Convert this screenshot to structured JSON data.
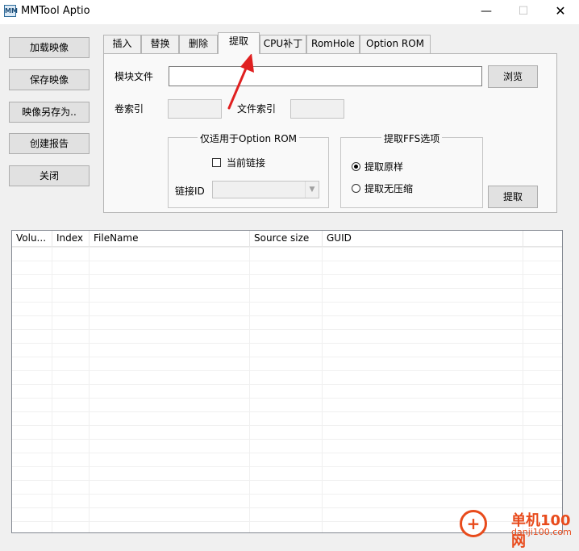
{
  "window": {
    "title": "MMTool Aptio",
    "icon_text": "MM",
    "minimize_glyph": "—",
    "maximize_glyph": "☐",
    "close_glyph": "✕"
  },
  "sidebar": {
    "buttons": [
      {
        "label": "加载映像"
      },
      {
        "label": "保存映像"
      },
      {
        "label": "映像另存为.."
      },
      {
        "label": "创建报告"
      },
      {
        "label": "关闭"
      }
    ]
  },
  "tabs": [
    {
      "label": "插入"
    },
    {
      "label": "替换"
    },
    {
      "label": "删除"
    },
    {
      "label": "提取",
      "active": true
    },
    {
      "label": "CPU补丁"
    },
    {
      "label": "RomHole"
    },
    {
      "label": "Option ROM"
    }
  ],
  "extract_panel": {
    "module_file_label": "模块文件",
    "module_file_value": "",
    "browse_button": "浏览",
    "volume_index_label": "卷索引",
    "volume_index_value": "",
    "file_index_label": "文件索引",
    "file_index_value": "",
    "option_rom_group": {
      "title": "仅适用于Option ROM",
      "checkbox_label": "当前链接",
      "checked": false,
      "link_id_label": "链接ID",
      "link_id_value": ""
    },
    "ffs_group": {
      "title": "提取FFS选项",
      "options": [
        {
          "label": "提取原样",
          "selected": true
        },
        {
          "label": "提取无压缩",
          "selected": false
        }
      ]
    },
    "extract_button": "提取"
  },
  "table": {
    "columns": [
      "Volu...",
      "Index",
      "FileName",
      "Source size",
      "GUID"
    ],
    "rows": []
  },
  "watermark": {
    "site_name": "单机100网",
    "site_url": "danji100.com",
    "logo_glyph": "+"
  },
  "colors": {
    "annotation_arrow": "#e02020",
    "watermark": "#e84b1c"
  }
}
